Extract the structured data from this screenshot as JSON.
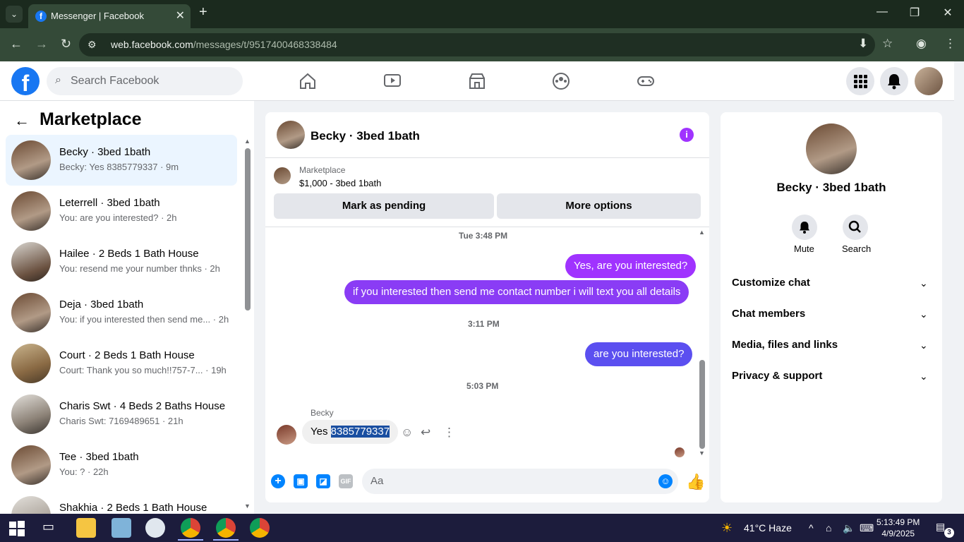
{
  "browser": {
    "tab_title": "Messenger | Facebook",
    "url_domain": "web.facebook.com",
    "url_path": "/messages/t/9517400468338484"
  },
  "facebook": {
    "search_placeholder": "Search Facebook"
  },
  "left": {
    "title": "Marketplace",
    "conversations": [
      {
        "name": "Becky · 3bed 1bath",
        "preview": "Becky: Yes 8385779337 · 9m"
      },
      {
        "name": "Leterrell · 3bed 1bath",
        "preview": "You: are you interested? · 2h"
      },
      {
        "name": "Hailee · 2 Beds 1 Bath House",
        "preview": "You: resend me your number thnks · 2h"
      },
      {
        "name": "Deja · 3bed 1bath",
        "preview": "You: if you interested then send me... · 2h"
      },
      {
        "name": "Court · 2 Beds 1 Bath House",
        "preview": "Court: Thank you so much!!757-7... · 19h"
      },
      {
        "name": "Charis Swt · 4 Beds 2 Baths House",
        "preview": "Charis Swt: 7169489651 · 21h"
      },
      {
        "name": "Tee · 3bed 1bath",
        "preview": "You: ? · 22h"
      },
      {
        "name": "Shakhia · 2 Beds 1 Bath House",
        "preview": ""
      }
    ]
  },
  "chat": {
    "name": "Becky · 3bed 1bath",
    "marketplace_label": "Marketplace",
    "listing": "$1,000 - 3bed 1bath",
    "mark_pending": "Mark as pending",
    "more_options": "More options",
    "timestamps": [
      "Tue 3:48 PM",
      "3:11 PM",
      "5:03 PM"
    ],
    "outgoing": [
      "Yes, are you interested?",
      "if you interested then send me contact number i will text you all details",
      "are you interested?"
    ],
    "sender": "Becky",
    "incoming_prefix": "Yes ",
    "incoming_selected": "8385779337",
    "composer_placeholder": "Aa",
    "gif_label": "GIF"
  },
  "info_panel": {
    "name": "Becky · 3bed 1bath",
    "mute": "Mute",
    "search": "Search",
    "sections": [
      "Customize chat",
      "Chat members",
      "Media, files and links",
      "Privacy & support"
    ]
  },
  "taskbar": {
    "weather": "41°C  Haze",
    "time": "5:13:49 PM",
    "date": "4/9/2025",
    "notifications": "3"
  },
  "colors": {
    "fb_blue": "#1877f2",
    "message_purple": "#a033ff",
    "messenger_blue": "#0084ff"
  }
}
